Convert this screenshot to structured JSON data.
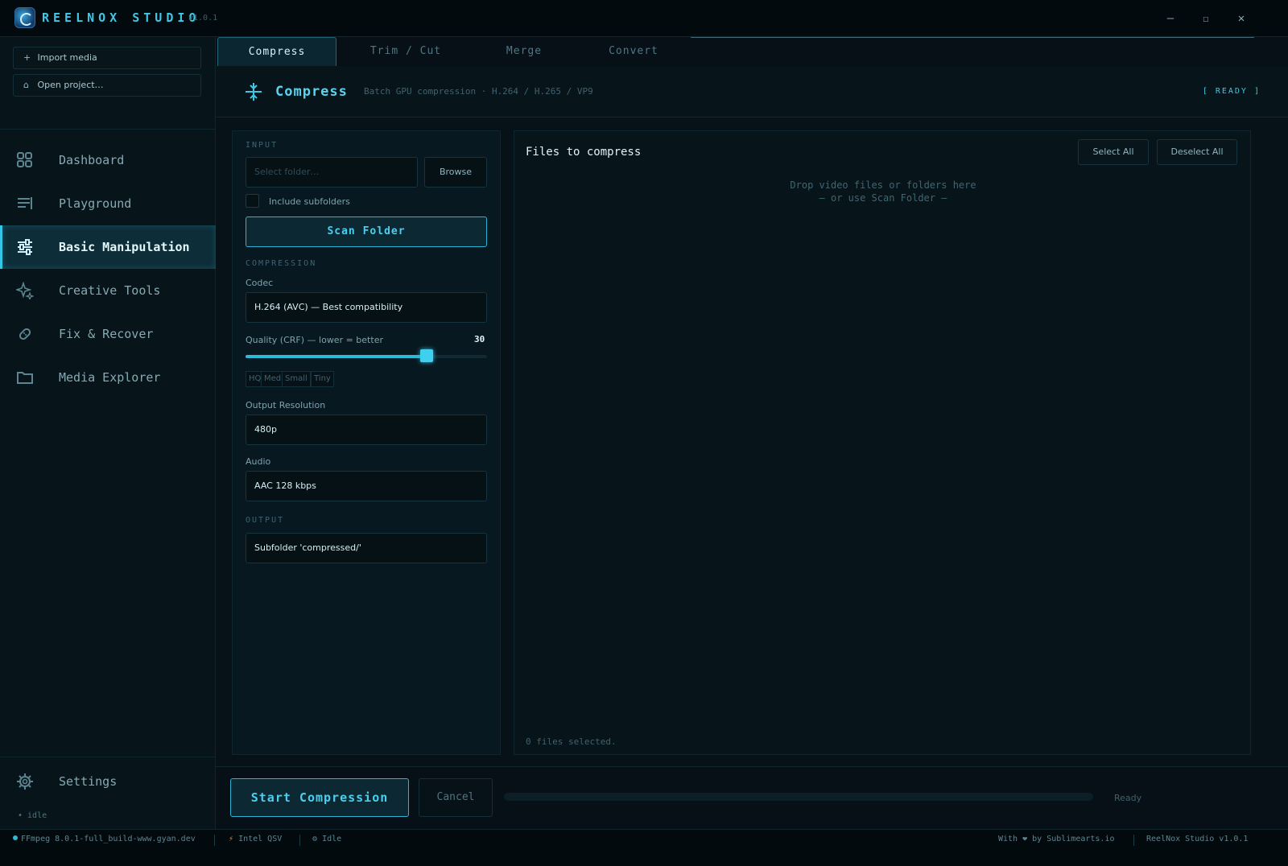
{
  "app": {
    "name": "REELNOX STUDIO",
    "version": "v1.0.1"
  },
  "window": {
    "minimize": "—",
    "maximize": "☐",
    "close": "✕"
  },
  "sidebar": {
    "import_label": "Import media",
    "open_label": "Open project…",
    "items": [
      {
        "label": "Dashboard"
      },
      {
        "label": "Playground"
      },
      {
        "label": "Basic Manipulation"
      },
      {
        "label": "Creative Tools"
      },
      {
        "label": "Fix & Recover"
      },
      {
        "label": "Media Explorer"
      }
    ],
    "active": "Basic Manipulation",
    "settings_label": "Settings",
    "idle_text": "• idle"
  },
  "tabs": [
    {
      "label": "Compress"
    },
    {
      "label": "Trim / Cut"
    },
    {
      "label": "Merge"
    },
    {
      "label": "Convert"
    }
  ],
  "header": {
    "title": "Compress",
    "subtitle": "Batch GPU compression · H.264 / H.265 / VP9",
    "status": "[ READY ]"
  },
  "input": {
    "section": "INPUT",
    "folder_placeholder": "Select folder…",
    "browse_label": "Browse",
    "subfolders_label": "Include subfolders",
    "subfolders_checked": false,
    "scan_label": "Scan Folder"
  },
  "compression": {
    "section": "COMPRESSION",
    "codec_label": "Codec",
    "codec_value": "H.264 (AVC)  — Best compatibility",
    "quality_label": "Quality (CRF)  —  lower = better",
    "quality_value": "30",
    "quality_fraction": 0.75,
    "presets": [
      "HQ",
      "Med",
      "Small",
      "Tiny"
    ],
    "resolution_label": "Output Resolution",
    "resolution_value": "480p",
    "audio_label": "Audio",
    "audio_value": "AAC 128 kbps"
  },
  "output": {
    "section": "OUTPUT",
    "value": "Subfolder 'compressed/'"
  },
  "files": {
    "title": "Files to compress",
    "select_all": "Select All",
    "deselect_all": "Deselect All",
    "drop_line1": "Drop video files or folders here",
    "drop_line2": "— or use Scan Folder —",
    "selected_count": "0 files selected."
  },
  "actions": {
    "start_label": "Start Compression",
    "cancel_label": "Cancel",
    "progress_fraction": 0,
    "progress_text": "Ready"
  },
  "status": {
    "ffmpeg": "FFmpeg 8.0.1-full_build-www.gyan.dev",
    "gpu": "Intel QSV",
    "state": "Idle",
    "credit": "With ❤ by Sublimearts.io",
    "version_text": "ReelNox Studio v1.0.1"
  },
  "colors": {
    "accent": "#2dbad9",
    "background": "#071218"
  }
}
